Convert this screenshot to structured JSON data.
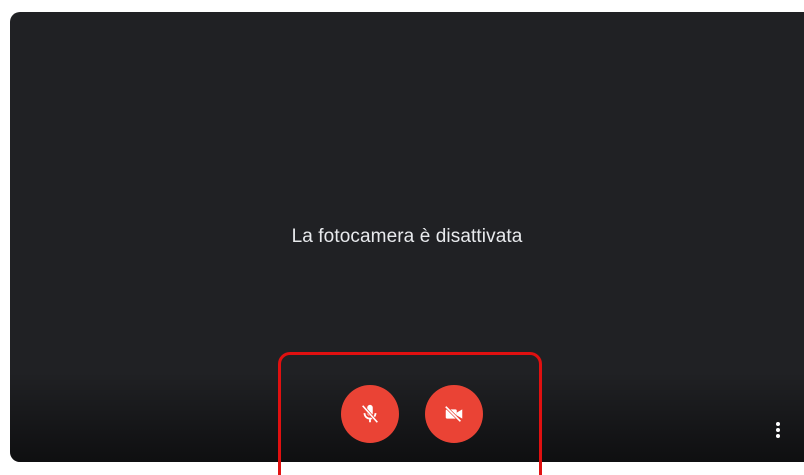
{
  "preview": {
    "status_text": "La fotocamera è disattivata",
    "background_color": "#202124"
  },
  "controls": {
    "mic_button": {
      "icon": "microphone-off-icon",
      "state": "off",
      "color": "#ea4335"
    },
    "camera_button": {
      "icon": "video-camera-off-icon",
      "state": "off",
      "color": "#ea4335"
    },
    "more_options": {
      "icon": "more-vert-icon"
    }
  },
  "annotation": {
    "highlight_color": "#e01010"
  }
}
